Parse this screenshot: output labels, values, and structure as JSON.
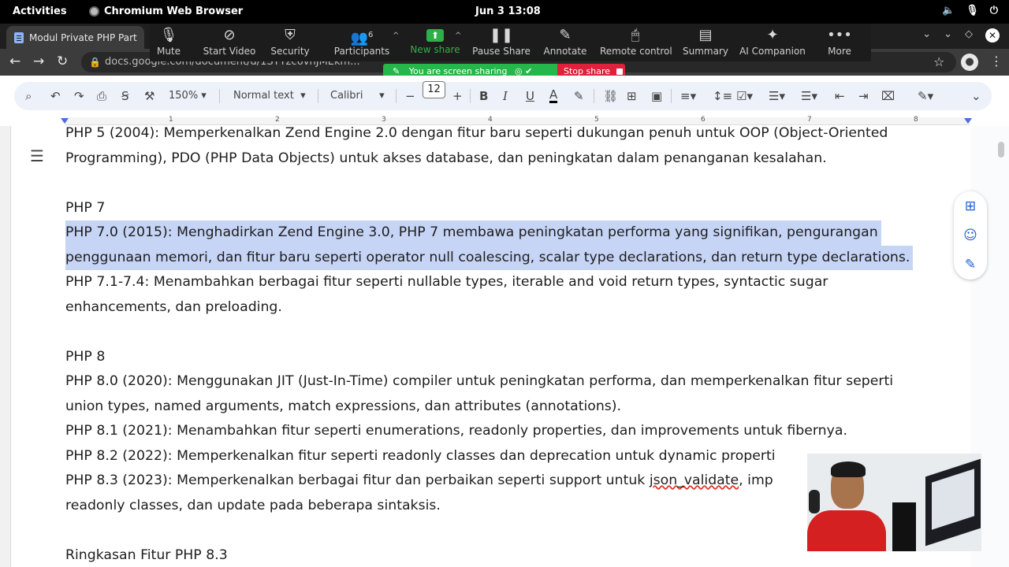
{
  "system_bar": {
    "activities": "Activities",
    "app_name": "Chromium Web Browser",
    "clock": "Jun 3  13:08",
    "tray_icons": [
      "speaker-icon",
      "microphone-icon",
      "power-icon"
    ]
  },
  "browser": {
    "tab_title": "Modul Private PHP Part",
    "url": "docs.google.com/document/d/1STYzc6vnJMEkm...",
    "window_controls": [
      "dropdown-icon",
      "chevron-icon",
      "diamond-icon",
      "close-icon"
    ]
  },
  "zoom": {
    "buttons": [
      {
        "label": "Mute",
        "icon": "microphone-icon"
      },
      {
        "label": "Start Video",
        "icon": "video-off-icon"
      },
      {
        "label": "Security",
        "icon": "shield-icon"
      },
      {
        "label": "Participants",
        "icon": "participants-icon",
        "count": "6"
      },
      {
        "label": "New share",
        "icon": "share-up-icon"
      },
      {
        "label": "Pause Share",
        "icon": "pause-icon"
      },
      {
        "label": "Annotate",
        "icon": "pen-icon"
      },
      {
        "label": "Remote control",
        "icon": "mouse-icon"
      },
      {
        "label": "Summary",
        "icon": "summary-icon"
      },
      {
        "label": "AI Companion",
        "icon": "sparkle-icon"
      },
      {
        "label": "More",
        "icon": "ellipsis-icon"
      }
    ],
    "sharing_banner": "You are screen sharing",
    "stop_share": "Stop share"
  },
  "docs_toolbar": {
    "zoom": "150%",
    "style": "Normal text",
    "font": "Calibri",
    "font_size": "12"
  },
  "ruler": {
    "numbers": [
      "1",
      "2",
      "3",
      "4",
      "5",
      "6",
      "7",
      "8"
    ]
  },
  "document": {
    "lines": [
      "PHP 5 (2004): Memperkenalkan Zend Engine 2.0 dengan fitur baru seperti dukungan penuh untuk OOP (Object-Oriented",
      "Programming), PDO (PHP Data Objects) untuk akses database, dan peningkatan dalam penanganan kesalahan.",
      "",
      "PHP 7",
      "PHP 7.0 (2015): Menghadirkan Zend Engine 3.0, PHP 7 membawa peningkatan performa yang signifikan, pengurangan",
      "penggunaan memori, dan fitur baru seperti operator null coalescing, scalar type declarations, dan return type declarations.",
      "PHP 7.1-7.4: Menambahkan berbagai fitur seperti nullable types, iterable and void return types, syntactic sugar",
      "enhancements, dan preloading.",
      "",
      "PHP 8",
      "PHP 8.0 (2020): Menggunakan JIT (Just-In-Time) compiler untuk peningkatan performa, dan memperkenalkan fitur seperti",
      "union types, named arguments, match expressions, dan attributes (annotations).",
      "PHP 8.1 (2021): Menambahkan fitur seperti enumerations, readonly properties, dan improvements untuk fibernya.",
      "PHP 8.2 (2022): Memperkenalkan fitur seperti readonly classes dan deprecation untuk dynamic properti",
      "PHP 8.3 (2023): Memperkenalkan berbagai fitur dan perbaikan seperti support untuk ",
      "readonly classes, dan update pada beberapa sintaksis.",
      "",
      "Ringkasan Fitur PHP 8.3"
    ],
    "line_14_spell": "json_validate",
    "line_14_tail": ", imp",
    "highlighted_lines": [
      4,
      5
    ]
  }
}
